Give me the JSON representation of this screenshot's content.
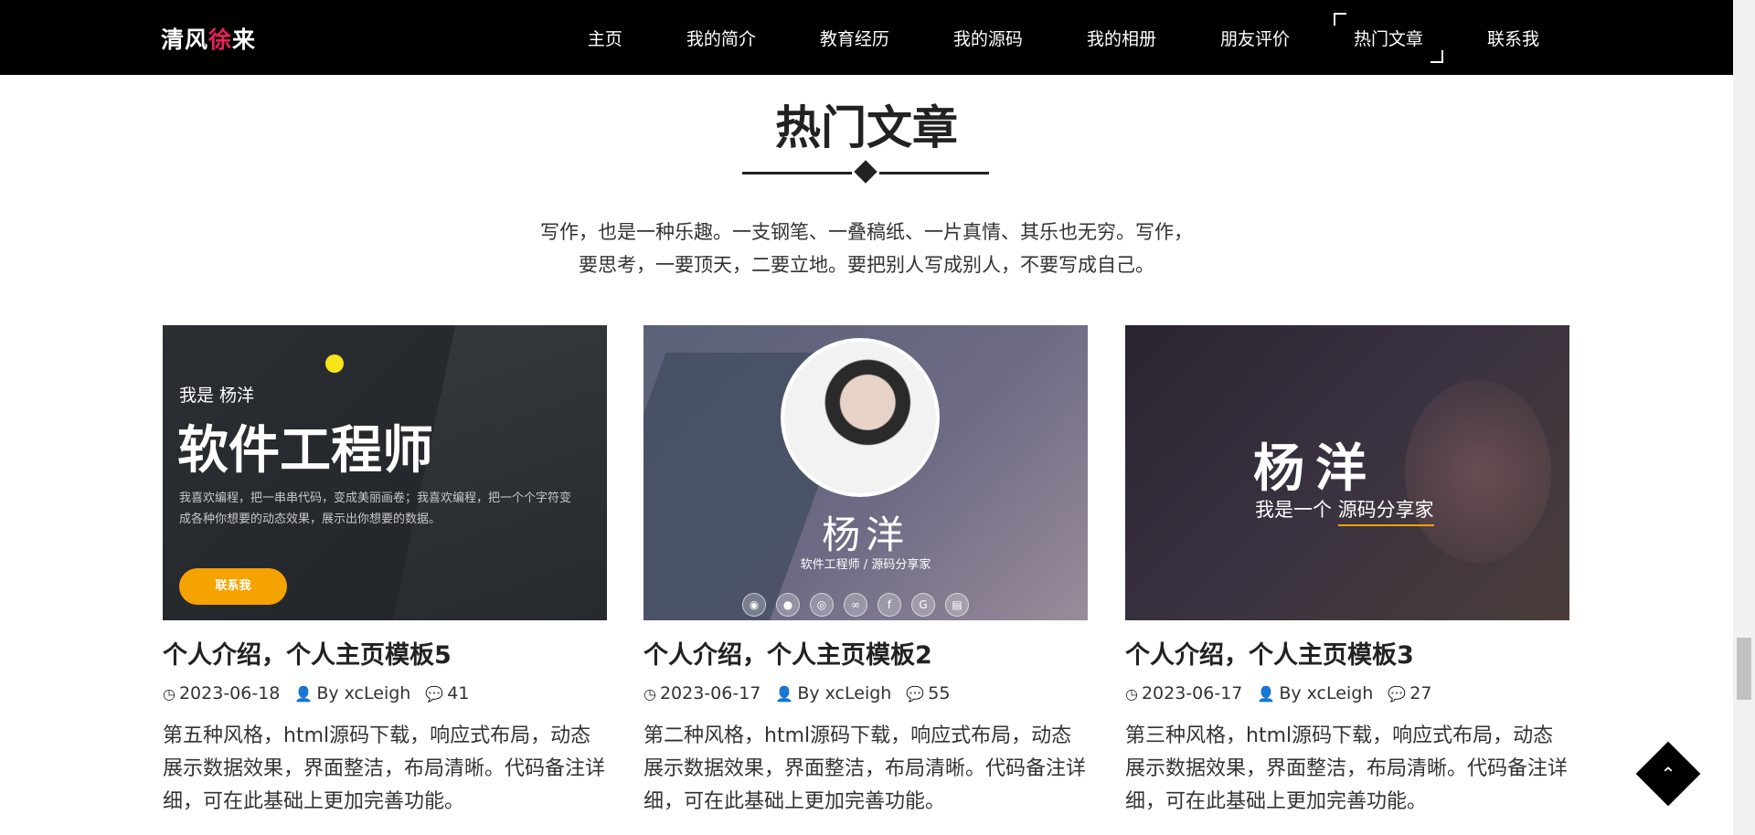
{
  "nav": {
    "logo_part1": "清风",
    "logo_accent": "徐",
    "logo_part2": "来",
    "items": [
      {
        "label": "主页"
      },
      {
        "label": "我的简介"
      },
      {
        "label": "教育经历"
      },
      {
        "label": "我的源码"
      },
      {
        "label": "我的相册"
      },
      {
        "label": "朋友评价"
      },
      {
        "label": "热门文章",
        "active": true
      },
      {
        "label": "联系我"
      }
    ]
  },
  "section": {
    "title": "热门文章",
    "intro_line1": "写作，也是一种乐趣。一支钢笔、一叠稿纸、一片真情、其乐也无穷。写作，",
    "intro_line2": "要思考，一要顶天，二要立地。要把别人写成别人，不要写成自己。"
  },
  "cards": [
    {
      "thumb": {
        "hi": "我是 杨洋",
        "big": "软件工程师",
        "small": "我喜欢编程，把一串串代码，变成美丽画卷；我喜欢编程，把一个个字符变成各种你想要的动态效果，展示出你想要的数据。",
        "button": "联系我"
      },
      "title": "个人介绍，个人主页模板5",
      "date": "2023-06-18",
      "by": "By",
      "author": "xcLeigh",
      "comments": "41",
      "desc": "第五种风格，html源码下载，响应式布局，动态展示数据效果，界面整洁，布局清晰。代码备注详细，可在此基础上更加完善功能。"
    },
    {
      "thumb": {
        "name": "杨洋",
        "sub": "软件工程师 / 源码分享家"
      },
      "title": "个人介绍，个人主页模板2",
      "date": "2023-06-17",
      "by": "By",
      "author": "xcLeigh",
      "comments": "55",
      "desc": "第二种风格，html源码下载，响应式布局，动态展示数据效果，界面整洁，布局清晰。代码备注详细，可在此基础上更加完善功能。"
    },
    {
      "thumb": {
        "name": "杨洋",
        "sub_prefix": "我是一个 ",
        "sub_highlight": "源码分享家"
      },
      "title": "个人介绍，个人主页模板3",
      "date": "2023-06-17",
      "by": "By",
      "author": "xcLeigh",
      "comments": "27",
      "desc": "第三种风格，html源码下载，响应式布局，动态展示数据效果，界面整洁，布局清晰。代码备注详细，可在此基础上更加完善功能。"
    }
  ],
  "colors": {
    "navbar_bg": "#000000",
    "logo_accent": "#e8215a",
    "button_orange": "#f5a300"
  },
  "icons": {
    "date": "clock-icon",
    "author": "user-icon",
    "comments": "comments-icon",
    "back_to_top": "chevron-up-icon"
  }
}
